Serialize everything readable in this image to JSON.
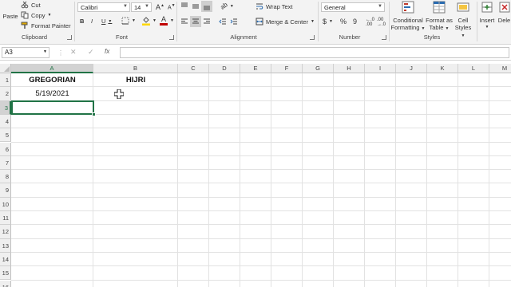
{
  "ribbon": {
    "clipboard": {
      "paste": "Paste",
      "cut": "Cut",
      "copy": "Copy",
      "format_painter": "Format Painter",
      "label": "Clipboard"
    },
    "font": {
      "name": "Calibri",
      "size": "14",
      "bold": "B",
      "italic": "I",
      "underline": "U",
      "font_color_glyph": "A",
      "label": "Font"
    },
    "alignment": {
      "wrap_text": "Wrap Text",
      "merge_center": "Merge & Center",
      "label": "Alignment"
    },
    "number": {
      "format": "General",
      "currency": "$",
      "percent": "%",
      "comma": "9",
      "label": "Number"
    },
    "styles": {
      "conditional_1": "Conditional",
      "conditional_2": "Formatting",
      "format_table_1": "Format as",
      "format_table_2": "Table",
      "cell_styles_1": "Cell",
      "cell_styles_2": "Styles",
      "label": "Styles"
    },
    "cells": {
      "insert": "Insert",
      "delete": "Dele"
    },
    "colors": {
      "font_color_bar": "#c00000",
      "fill_color_bar": "#ffd800",
      "selection_border": "#217346"
    }
  },
  "formula_bar": {
    "name_box": "A3",
    "fx": "fx",
    "cancel": "✕",
    "enter": "✓",
    "value": ""
  },
  "sheet": {
    "columns": [
      "A",
      "B",
      "C",
      "D",
      "E",
      "F",
      "G",
      "H",
      "I",
      "J",
      "K",
      "L",
      "M"
    ],
    "rows": [
      "1",
      "2",
      "3",
      "4",
      "5",
      "6",
      "7",
      "8",
      "9",
      "10",
      "11",
      "12",
      "13",
      "14",
      "15",
      "16"
    ],
    "cells": {
      "A1": "GREGORIAN",
      "B1": "HIJRI",
      "A2": "5/19/2021"
    },
    "selected_cell": "A3"
  }
}
